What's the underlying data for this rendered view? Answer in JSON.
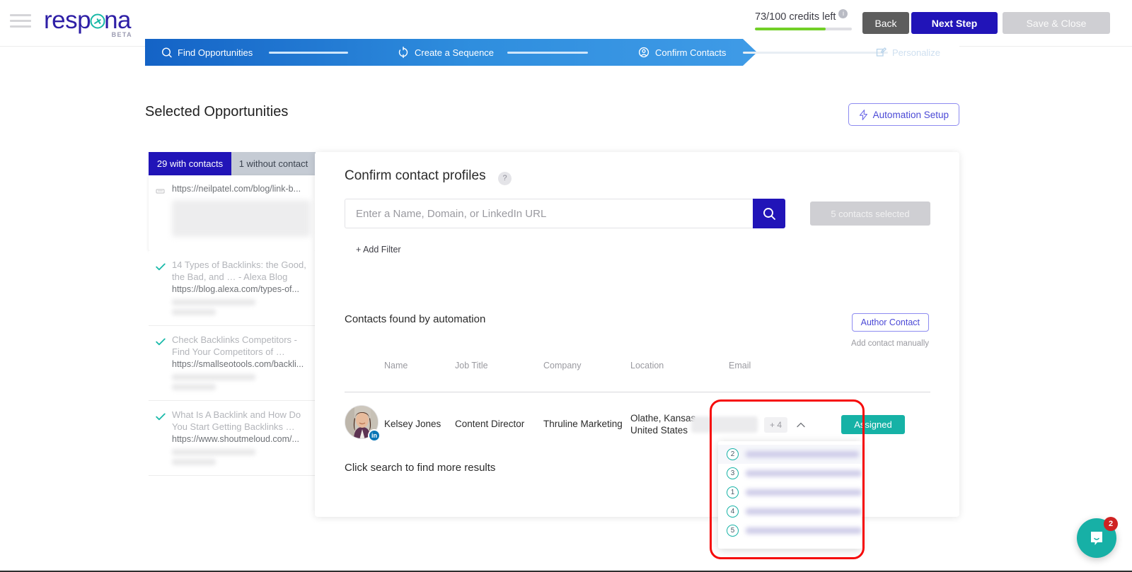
{
  "brand": {
    "logo_text_before": "resp",
    "logo_text_o": "o",
    "logo_text_after": "na",
    "beta_label": "BETA",
    "accent_teal": "#17b8a6",
    "accent_indigo": "#2e1fa6"
  },
  "header": {
    "menu_icon": "hamburger-icon",
    "credits_text": "73/100 credits left",
    "credits_used": 73,
    "credits_total": 100,
    "credits_progress_percent": 73,
    "info_icon": "i",
    "back_label": "Back",
    "next_label": "Next Step",
    "save_close_label": "Save & Close"
  },
  "stepper": {
    "steps": [
      {
        "label": "Find Opportunities",
        "icon": "search-icon",
        "state": "done"
      },
      {
        "label": "Create a Sequence",
        "icon": "refresh-icon",
        "state": "done"
      },
      {
        "label": "Confirm Contacts",
        "icon": "user-circle-icon",
        "state": "current"
      },
      {
        "label": "Personalize",
        "icon": "edit-square-icon",
        "state": "upcoming"
      }
    ]
  },
  "page": {
    "section_title": "Selected Opportunities",
    "automation_button": "Automation Setup",
    "automation_icon": "lightning-icon"
  },
  "opportunities": {
    "tabs": [
      {
        "label": "29 with contacts",
        "active": true
      },
      {
        "label": "1 without contact",
        "active": false
      }
    ],
    "items": [
      {
        "title": "",
        "url": "https://neilpatel.com/blog/link-b...",
        "checked": true,
        "partial": true
      },
      {
        "title": "14 Types of Backlinks: the Good, the Bad, and … - Alexa Blog",
        "url": "https://blog.alexa.com/types-of...",
        "checked": true
      },
      {
        "title": "Check Backlinks Competitors - Find Your Competitors of …",
        "url": "https://smallseotools.com/backli...",
        "checked": true
      },
      {
        "title": "What Is A Backlink and How Do You Start Getting Backlinks …",
        "url": "https://www.shoutmeloud.com/...",
        "checked": true
      }
    ]
  },
  "main": {
    "title": "Confirm contact profiles",
    "help_icon": "?",
    "search": {
      "placeholder": "Enter a Name, Domain, or LinkedIn URL",
      "value": "",
      "button_icon": "search-icon"
    },
    "selected_chip": "5 contacts selected",
    "add_filter": "+  Add Filter",
    "found_label": "Contacts found by automation",
    "author_contact_button": "Author Contact",
    "add_manually_hint": "Add contact manually",
    "columns": [
      "Name",
      "Job Title",
      "Company",
      "Location",
      "Email"
    ],
    "contacts": [
      {
        "name": "Kelsey Jones",
        "job_title": "Content Director",
        "company": "Thruline Marketing",
        "location": "Olathe, Kansas, United States",
        "email_masked": "",
        "email_more": "+ 4",
        "social_badge": "in",
        "status": "Assigned"
      }
    ],
    "email_dropdown": {
      "open": true,
      "collapse_icon": "chevron-up-icon",
      "options": [
        {
          "rank": "2",
          "value": "",
          "highlighted": true,
          "blur_width": 160
        },
        {
          "rank": "3",
          "value": "",
          "highlighted": false,
          "blur_width": 182
        },
        {
          "rank": "1",
          "value": "",
          "highlighted": false,
          "blur_width": 178
        },
        {
          "rank": "4",
          "value": "",
          "highlighted": false,
          "blur_width": 186
        },
        {
          "rank": "5",
          "value": "",
          "highlighted": false,
          "blur_width": 170
        }
      ]
    },
    "footer_note": "Click search to find more results"
  },
  "annotation": {
    "highlight_color": "#f60b0b",
    "shape": "rounded-rect"
  },
  "intercom": {
    "icon": "chat-bubble-icon",
    "unread_count": "2",
    "color": "#17b0a6"
  }
}
